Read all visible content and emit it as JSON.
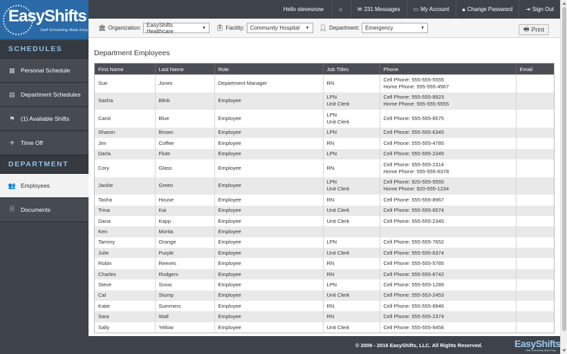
{
  "logo": {
    "name": "EasyShifts",
    "tagline": "Staff Scheduling Made Easy"
  },
  "sidebar": {
    "schedules_heading": "SCHEDULES",
    "department_heading": "DEPARTMENT",
    "schedule_items": [
      {
        "label": "Personal Schedule",
        "icon": "calendar-icon"
      },
      {
        "label": "Department Schedules",
        "icon": "calendar-grid-icon"
      },
      {
        "label": "(1) Available Shifts",
        "icon": "flag-icon"
      },
      {
        "label": "Time Off",
        "icon": "plane-icon"
      }
    ],
    "department_items": [
      {
        "label": "Employees",
        "icon": "users-icon",
        "active": true
      },
      {
        "label": "Documents",
        "icon": "document-icon"
      }
    ]
  },
  "topbar": {
    "hello": "Hello stevesnow",
    "messages": "231 Messages",
    "account": "My Account",
    "change_password": "Change Password",
    "sign_out": "Sign Out"
  },
  "filters": {
    "organization_label": "Organization:",
    "organization_value": "EasyShifts Healthcare",
    "facility_label": "Facility:",
    "facility_value": "Community Hospital",
    "department_label": "Department:",
    "department_value": "Emergency",
    "print_label": "Print"
  },
  "page": {
    "title": "Department Employees"
  },
  "table": {
    "headers": [
      "First Name",
      "Last Name",
      "Role",
      "Job Titles",
      "Phone",
      "Email"
    ],
    "rows": [
      {
        "first": "Sue",
        "last": "Jones",
        "role": "Department Manager",
        "titles": [
          "RN"
        ],
        "phones": [
          "Cell Phone: 555-555-5555",
          "Home Phone: 555-555-4567"
        ],
        "email": ""
      },
      {
        "first": "Sasha",
        "last": "Blink",
        "role": "Employee",
        "titles": [
          "LPN",
          "Unit Clerk"
        ],
        "phones": [
          "Cell Phone: 555-555-8923",
          "Home Phone: 555-555-5555"
        ],
        "email": ""
      },
      {
        "first": "Carol",
        "last": "Blue",
        "role": "Employee",
        "titles": [
          "LPN",
          "Unit Clerk"
        ],
        "phones": [
          "Cell Phone: 555-555-8575"
        ],
        "email": ""
      },
      {
        "first": "Sharon",
        "last": "Brown",
        "role": "Employee",
        "titles": [
          "LPN"
        ],
        "phones": [
          "Cell Phone: 555-555-6345"
        ],
        "email": ""
      },
      {
        "first": "Jim",
        "last": "Coffee",
        "role": "Employee",
        "titles": [
          "RN"
        ],
        "phones": [
          "Cell Phone: 555-555-4785"
        ],
        "email": ""
      },
      {
        "first": "Darla",
        "last": "Flute",
        "role": "Employee",
        "titles": [
          "LPN"
        ],
        "phones": [
          "Cell Phone: 555-555-2345"
        ],
        "email": ""
      },
      {
        "first": "Cory",
        "last": "Glass",
        "role": "Employee",
        "titles": [
          "RN"
        ],
        "phones": [
          "Cell Phone: 555-555-2314",
          "Home Phone: 555-555-6378"
        ],
        "email": ""
      },
      {
        "first": "Jackie",
        "last": "Green",
        "role": "Employee",
        "titles": [
          "LPN",
          "Unit Clerk"
        ],
        "phones": [
          "Cell Phone: 920-555-5555",
          "Home Phone: 920-555-1234"
        ],
        "email": ""
      },
      {
        "first": "Tasha",
        "last": "House",
        "role": "Employee",
        "titles": [
          "RN"
        ],
        "phones": [
          "Cell Phone: 555-555-8967"
        ],
        "email": ""
      },
      {
        "first": "Trina",
        "last": "Kai",
        "role": "Employee",
        "titles": [
          "Unit Clerk"
        ],
        "phones": [
          "Cell Phone: 555-555-6574"
        ],
        "email": ""
      },
      {
        "first": "Dana",
        "last": "Kapp",
        "role": "Employee",
        "titles": [
          "Unit Clerk"
        ],
        "phones": [
          "Cell Phone: 555-555-2345"
        ],
        "email": ""
      },
      {
        "first": "Ken",
        "last": "Morita",
        "role": "Employee",
        "titles": [],
        "phones": [],
        "email": ""
      },
      {
        "first": "Tammy",
        "last": "Orange",
        "role": "Employee",
        "titles": [
          "LPN"
        ],
        "phones": [
          "Cell Phone: 555-555-7652"
        ],
        "email": ""
      },
      {
        "first": "Julie",
        "last": "Purple",
        "role": "Employee",
        "titles": [
          "Unit Clerk"
        ],
        "phones": [
          "Cell Phone: 555-555-6374"
        ],
        "email": ""
      },
      {
        "first": "Robin",
        "last": "Reeves",
        "role": "Employee",
        "titles": [
          "RN"
        ],
        "phones": [
          "Cell Phone: 555-555-5785"
        ],
        "email": ""
      },
      {
        "first": "Charles",
        "last": "Rodgers",
        "role": "Employee",
        "titles": [
          "RN"
        ],
        "phones": [
          "Cell Phone: 555-555-6742"
        ],
        "email": ""
      },
      {
        "first": "Steve",
        "last": "Snow",
        "role": "Employee",
        "titles": [
          "LPN"
        ],
        "phones": [
          "Cell Phone: 555-555-1289"
        ],
        "email": ""
      },
      {
        "first": "Cal",
        "last": "Stump",
        "role": "Employee",
        "titles": [
          "Unit Clerk"
        ],
        "phones": [
          "Cell Phone: 555-553-2453"
        ],
        "email": ""
      },
      {
        "first": "Katie",
        "last": "Summers",
        "role": "Employee",
        "titles": [
          "RN"
        ],
        "phones": [
          "Cell Phone: 555-555-8946"
        ],
        "email": ""
      },
      {
        "first": "Sara",
        "last": "Wall",
        "role": "Employee",
        "titles": [
          "RN"
        ],
        "phones": [
          "Cell Phone: 555-555-2374"
        ],
        "email": ""
      },
      {
        "first": "Sally",
        "last": "Yellow",
        "role": "Employee",
        "titles": [
          "Unit Clerk"
        ],
        "phones": [
          "Cell Phone: 555-555-9456"
        ],
        "email": ""
      }
    ]
  },
  "footer": {
    "copyright": "© 2009 - 2016 EasyShifts, LLC. All Rights Reserved.",
    "logo_name": "EasyShifts",
    "logo_tagline": "Staff Scheduling Made Easy"
  },
  "colors": {
    "sidebar_bg": "#3d4349",
    "accent": "#8ec1ea",
    "logo_blue": "#2a6aa8",
    "active_icon": "#e25b5b"
  }
}
